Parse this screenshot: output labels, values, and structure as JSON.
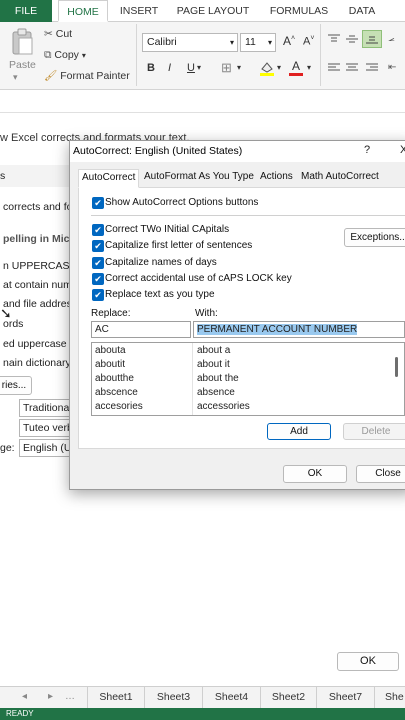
{
  "ribbon_tabs": [
    "FILE",
    "HOME",
    "INSERT",
    "PAGE LAYOUT",
    "FORMULAS",
    "DATA"
  ],
  "clipboard": {
    "cut": "Cut",
    "copy": "Copy",
    "paste": "Paste",
    "format_painter": "Format Painter"
  },
  "font": {
    "name": "Calibri",
    "size": "11"
  },
  "background": {
    "heading": "w Excel corrects and formats your text.",
    "side_label": "s",
    "corrects_line": "corrects and fo",
    "spelling_heading": "pelling in Micro",
    "uppercase_line": "n UPPERCASE",
    "contain_line": "at contain num",
    "file_address_line": "and file addres",
    "words_line": "ords",
    "flagged_line": "ed uppercase in",
    "dictionary_line": "nain dictionary",
    "custom_button": "ries...",
    "dropdown1": "Traditiona",
    "dropdown2": "Tuteo verb",
    "language_label": "ge:",
    "language_value": "English (U",
    "ok_button": "OK"
  },
  "dialog": {
    "title": "AutoCorrect: English (United States)",
    "help": "?",
    "close": "X",
    "tabs": [
      "AutoCorrect",
      "AutoFormat As You Type",
      "Actions",
      "Math AutoCorrect"
    ],
    "show_buttons_label": "Show AutoCorrect Options buttons",
    "options": [
      "Correct TWo INitial CApitals",
      "Capitalize first letter of sentences",
      "Capitalize names of days",
      "Correct accidental use of cAPS LOCK key",
      "Replace text as you type"
    ],
    "exceptions_button": "Exceptions...",
    "replace_label": "Replace:",
    "with_label": "With:",
    "replace_value": "AC",
    "with_value": "PERMANENT ACCOUNT NUMBER",
    "entries": [
      {
        "from": "abouta",
        "to": "about a"
      },
      {
        "from": "aboutit",
        "to": "about it"
      },
      {
        "from": "aboutthe",
        "to": "about the"
      },
      {
        "from": "abscence",
        "to": "absence"
      },
      {
        "from": "accesories",
        "to": "accessories"
      }
    ],
    "add_button": "Add",
    "delete_button": "Delete",
    "ok_button": "OK",
    "close_button": "Close"
  },
  "sheets": [
    "Sheet1",
    "Sheet3",
    "Sheet4",
    "Sheet2",
    "Sheet7",
    "She"
  ],
  "status": "READY",
  "colors": {
    "excel_green": "#217346",
    "accent_blue": "#0067c0",
    "selection": "#99c9ef"
  }
}
